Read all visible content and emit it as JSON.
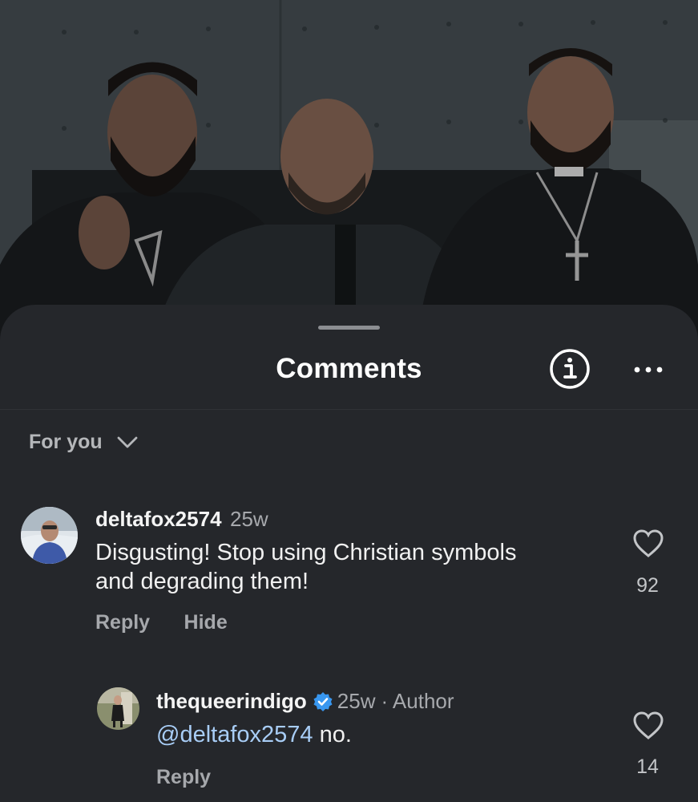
{
  "sheet": {
    "title": "Comments",
    "info_icon": "info-icon",
    "more_icon": "more-horizontal-icon"
  },
  "sort": {
    "label": "For you",
    "icon": "chevron-down-icon"
  },
  "comments": [
    {
      "username": "deltafox2574",
      "age": "25w",
      "text": "Disgusting! Stop using Christian symbols and degrading them!",
      "text_line1": "Disgusting! Stop using Christian symbols",
      "text_line2": "and degrading them!",
      "likes": "92",
      "actions": {
        "reply": "Reply",
        "hide": "Hide"
      }
    },
    {
      "username": "thequeerindigo",
      "verified": true,
      "age": "25w",
      "author_tag": "· Author",
      "mention": "@deltafox2574",
      "text": " no.",
      "likes": "14",
      "actions": {
        "reply": "Reply"
      }
    }
  ],
  "colors": {
    "sheet_bg": "#25272b",
    "verified_badge": "#3897f0",
    "mention": "#a8cdf6",
    "secondary_text": "#a7a9ad"
  }
}
